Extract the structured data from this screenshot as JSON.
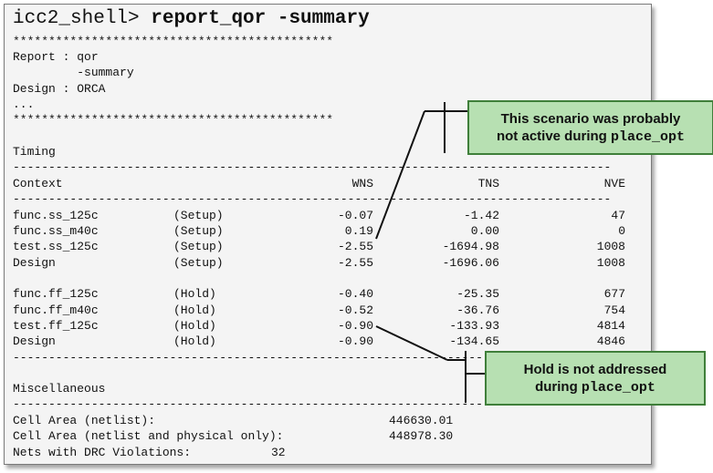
{
  "prompt": {
    "host": "icc2_shell>",
    "command": "report_qor -summary"
  },
  "header": {
    "stars": "*********************************************",
    "report_line": "Report : qor",
    "option_line": "         -summary",
    "design_line": "Design : ORCA",
    "ellipsis": "..."
  },
  "timing": {
    "section_title": "Timing",
    "dashes": "------------------------------------------------------------------------------------",
    "columns": {
      "context": "Context",
      "wns": "WNS",
      "tns": "TNS",
      "nve": "NVE"
    },
    "setup_rows": [
      {
        "context": "func.ss_125c",
        "type": "(Setup)",
        "wns": "-0.07",
        "tns": "-1.42",
        "nve": "47"
      },
      {
        "context": "func.ss_m40c",
        "type": "(Setup)",
        "wns": "0.19",
        "tns": "0.00",
        "nve": "0"
      },
      {
        "context": "test.ss_125c",
        "type": "(Setup)",
        "wns": "-2.55",
        "tns": "-1694.98",
        "nve": "1008"
      },
      {
        "context": "Design",
        "type": "(Setup)",
        "wns": "-2.55",
        "tns": "-1696.06",
        "nve": "1008"
      }
    ],
    "hold_rows": [
      {
        "context": "func.ff_125c",
        "type": "(Hold)",
        "wns": "-0.40",
        "tns": "-25.35",
        "nve": "677"
      },
      {
        "context": "func.ff_m40c",
        "type": "(Hold)",
        "wns": "-0.52",
        "tns": "-36.76",
        "nve": "754"
      },
      {
        "context": "test.ff_125c",
        "type": "(Hold)",
        "wns": "-0.90",
        "tns": "-133.93",
        "nve": "4814"
      },
      {
        "context": "Design",
        "type": "(Hold)",
        "wns": "-0.90",
        "tns": "-134.65",
        "nve": "4846"
      }
    ]
  },
  "misc": {
    "section_title": "Miscellaneous",
    "rows": [
      {
        "label": "Cell Area (netlist):",
        "value": "446630.01"
      },
      {
        "label": "Cell Area (netlist and physical only):",
        "value": "448978.30"
      },
      {
        "label": "Nets with DRC Violations:",
        "value": "32"
      }
    ]
  },
  "callouts": {
    "scenario": {
      "line1": "This scenario was probably",
      "line2_text": "not active during ",
      "line2_code": "place_opt"
    },
    "hold": {
      "line1": "Hold is not addressed",
      "line2_text": "during ",
      "line2_code": "place_opt"
    }
  },
  "colors": {
    "callout_fill": "#b7e0b2",
    "callout_border": "#3f7f3a",
    "terminal_bg": "#f4f4f4"
  }
}
